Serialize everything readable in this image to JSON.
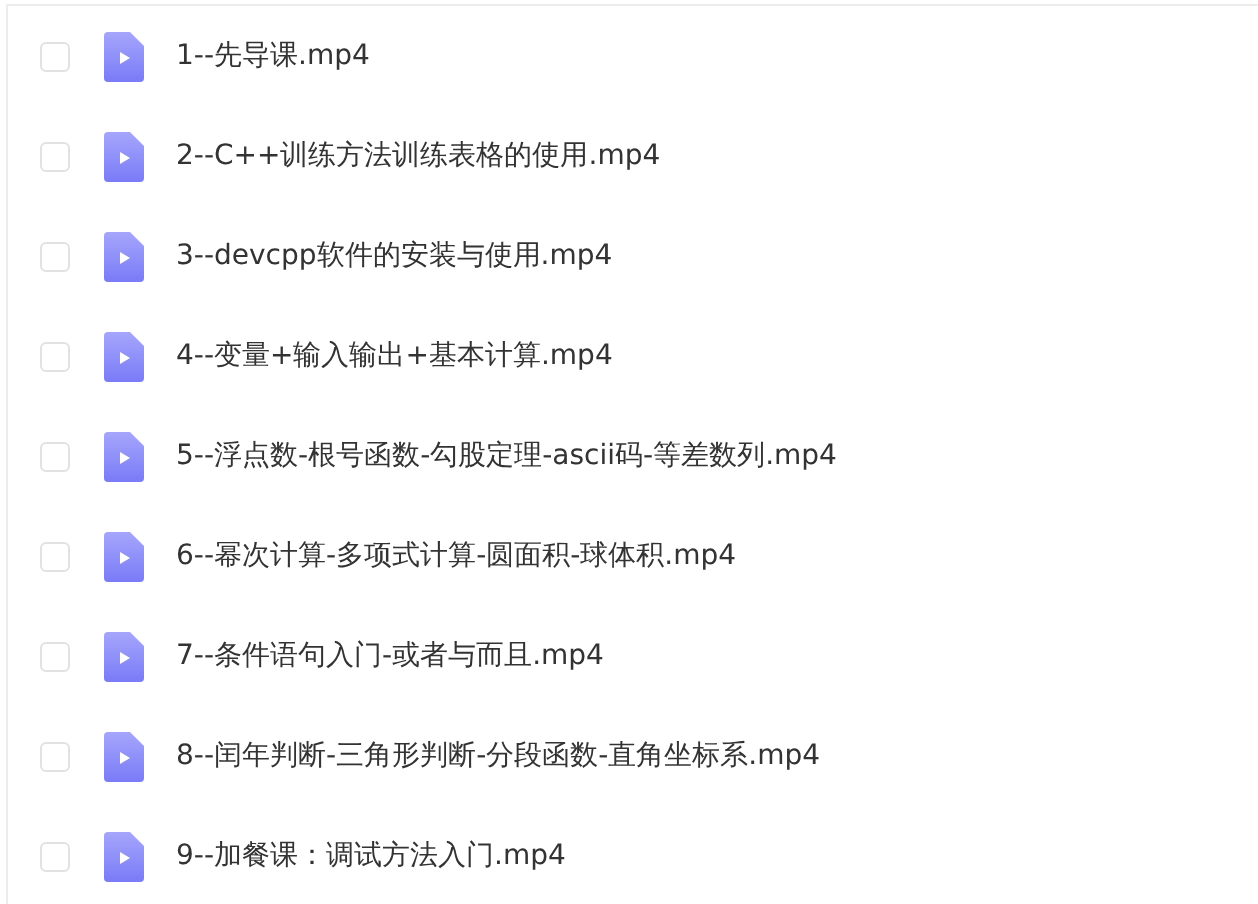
{
  "files": [
    {
      "name": "1--先导课.mp4",
      "checked": false
    },
    {
      "name": "2--C++训练方法训练表格的使用.mp4",
      "checked": false
    },
    {
      "name": "3--devcpp软件的安装与使用.mp4",
      "checked": false
    },
    {
      "name": "4--变量+输入输出+基本计算.mp4",
      "checked": false
    },
    {
      "name": "5--浮点数-根号函数-勾股定理-ascii码-等差数列.mp4",
      "checked": false
    },
    {
      "name": "6--幂次计算-多项式计算-圆面积-球体积.mp4",
      "checked": false
    },
    {
      "name": "7--条件语句入门-或者与而且.mp4",
      "checked": false
    },
    {
      "name": "8--闰年判断-三角形判断-分段函数-直角坐标系.mp4",
      "checked": false
    },
    {
      "name": "9--加餐课：调试方法入门.mp4",
      "checked": false
    }
  ]
}
